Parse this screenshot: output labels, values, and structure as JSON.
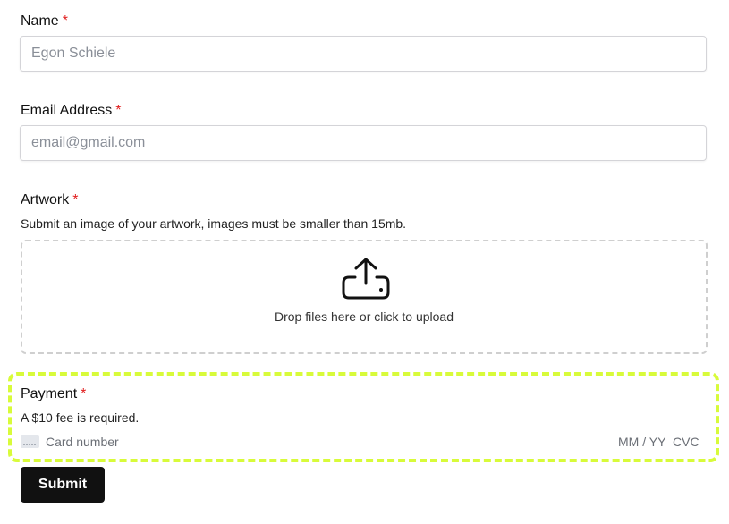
{
  "form": {
    "name": {
      "label": "Name",
      "required_mark": "*",
      "placeholder": "Egon Schiele"
    },
    "email": {
      "label": "Email Address",
      "required_mark": "*",
      "placeholder": "email@gmail.com"
    },
    "artwork": {
      "label": "Artwork",
      "required_mark": "*",
      "help": "Submit an image of your artwork, images must be smaller than 15mb.",
      "dropzone_text": "Drop files here or click to upload",
      "icon": "upload-icon"
    },
    "payment": {
      "label": "Payment",
      "required_mark": "*",
      "help": "A $10 fee is required.",
      "card_number_placeholder": "Card number",
      "expiry_placeholder": "MM / YY",
      "cvc_placeholder": "CVC",
      "icon": "credit-card-icon"
    },
    "submit_label": "Submit"
  },
  "colors": {
    "required": "#e11d1d",
    "highlight": "#d8fb3a",
    "button_bg": "#111111",
    "button_text": "#ffffff"
  }
}
